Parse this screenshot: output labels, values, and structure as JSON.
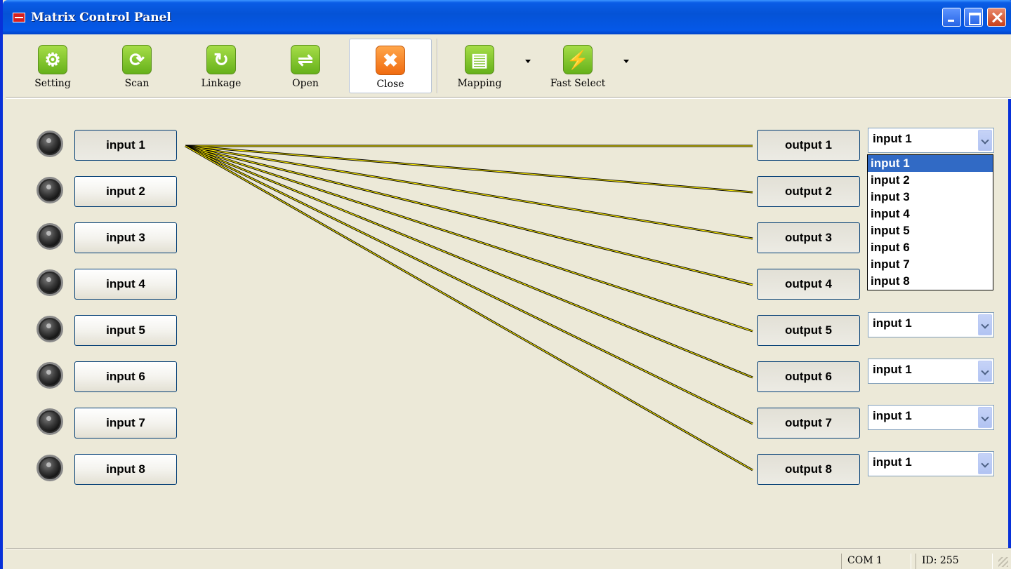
{
  "window": {
    "title": "Matrix Control Panel"
  },
  "toolbar": {
    "buttons": [
      {
        "label": "Setting",
        "icon": "wrench-icon"
      },
      {
        "label": "Scan",
        "icon": "scan-ring-icon"
      },
      {
        "label": "Linkage",
        "icon": "refresh-icon"
      },
      {
        "label": "Open",
        "icon": "connect-icon"
      },
      {
        "label": "Close",
        "icon": "close-x-icon"
      },
      {
        "label": "Mapping",
        "icon": "chart-icon"
      },
      {
        "label": "Fast Select",
        "icon": "lightning-icon"
      }
    ]
  },
  "inputs": [
    "input 1",
    "input 2",
    "input 3",
    "input 4",
    "input 5",
    "input 6",
    "input 7",
    "input 8"
  ],
  "outputs": [
    {
      "label": "output 1",
      "source": "input 1"
    },
    {
      "label": "output 2",
      "source": "input 1"
    },
    {
      "label": "output 3",
      "source": "input 1"
    },
    {
      "label": "output 4",
      "source": "input 1"
    },
    {
      "label": "output 5",
      "source": "input 1"
    },
    {
      "label": "output 6",
      "source": "input 1"
    },
    {
      "label": "output 7",
      "source": "input 1"
    },
    {
      "label": "output 8",
      "source": "input 1"
    }
  ],
  "dropdown": {
    "open_for": "output 1",
    "options": [
      "input 1",
      "input 2",
      "input 3",
      "input 4",
      "input 5",
      "input 6",
      "input 7",
      "input 8"
    ],
    "highlighted": "input 1"
  },
  "colors": {
    "route_line": "#f7e600",
    "route_line_edge": "#000000"
  },
  "status": {
    "port": "COM 1",
    "id": "ID: 255"
  }
}
